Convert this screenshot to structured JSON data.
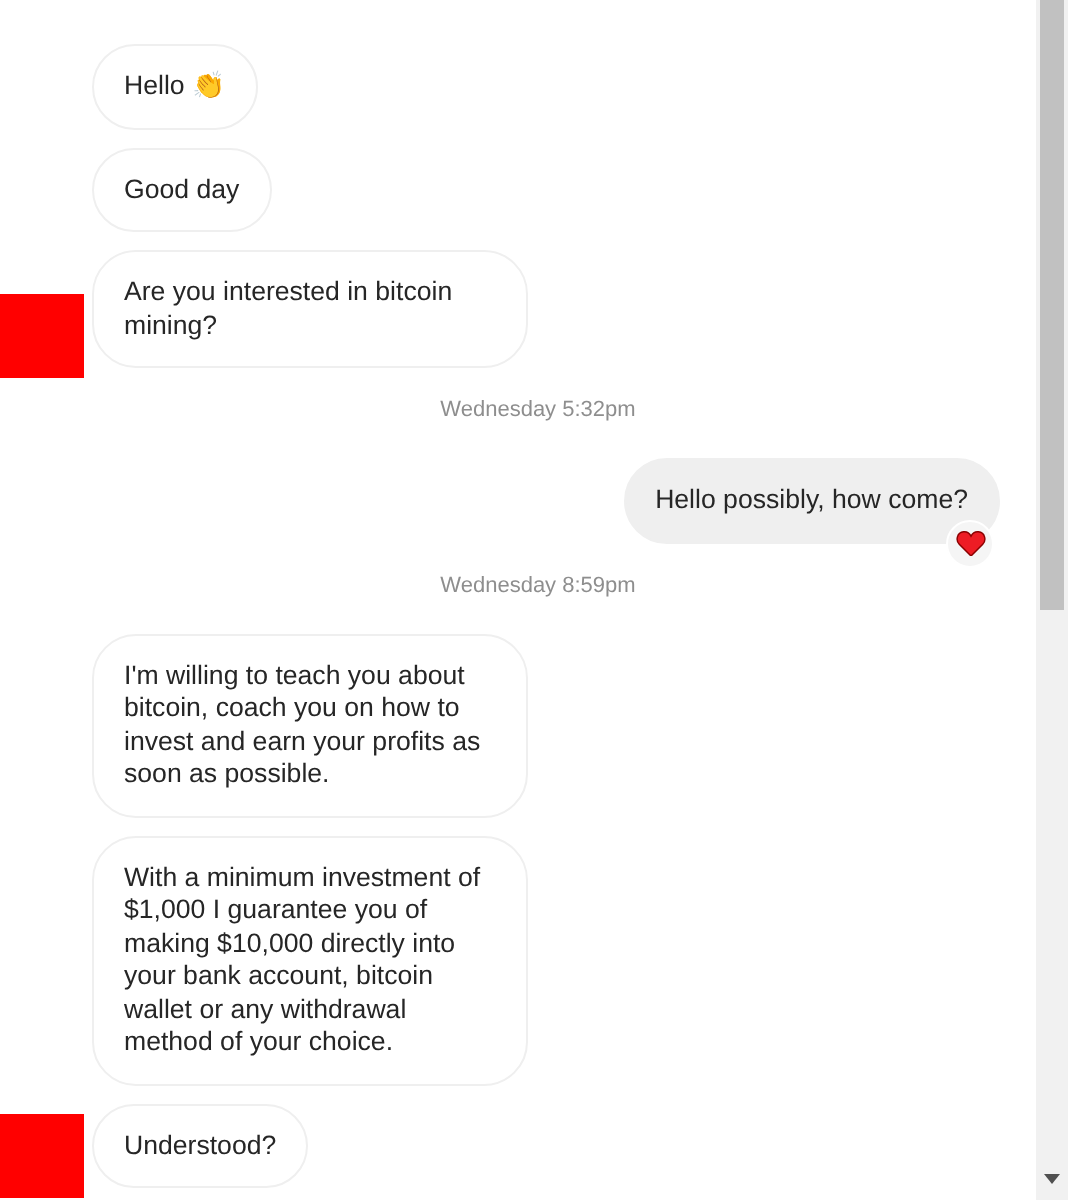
{
  "messages": [
    {
      "kind": "incoming",
      "text": "Hello 👏",
      "avatar": false,
      "reacted": false
    },
    {
      "kind": "incoming",
      "text": "Good day",
      "avatar": false,
      "reacted": false
    },
    {
      "kind": "incoming",
      "text": "Are you interested in bitcoin mining?",
      "avatar": true,
      "reacted": false
    },
    {
      "kind": "time",
      "text": "Wednesday 5:32pm"
    },
    {
      "kind": "outgoing",
      "text": "Hello possibly, how come?",
      "avatar": false,
      "reacted": true
    },
    {
      "kind": "time",
      "text": "Wednesday 8:59pm"
    },
    {
      "kind": "incoming",
      "text": "I'm willing to teach you about bitcoin, coach you on how to invest and earn your profits as soon as possible.",
      "avatar": false,
      "reacted": false
    },
    {
      "kind": "incoming",
      "text": "With a minimum investment of $1,000 I guarantee you of making $10,000 directly into your bank account, bitcoin wallet or any withdrawal method of your choice.",
      "avatar": false,
      "reacted": false
    },
    {
      "kind": "incoming",
      "text": "Understood?",
      "avatar": true,
      "reacted": false
    }
  ]
}
